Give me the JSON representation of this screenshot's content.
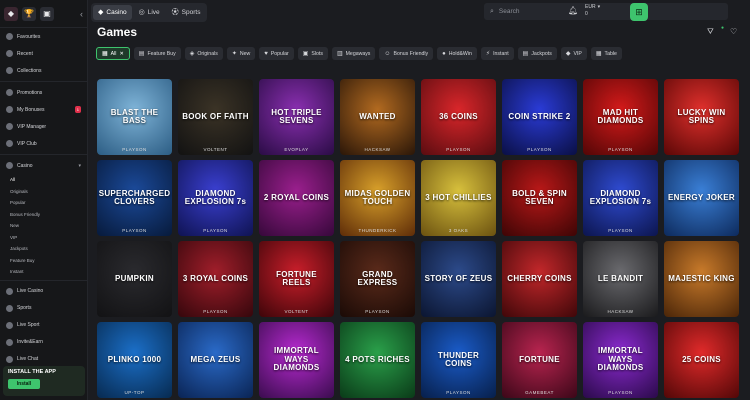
{
  "sidebar": {
    "collapse_icon": "chevron-left-icon",
    "main_items": [
      {
        "label": "Favourites"
      },
      {
        "label": "Recent"
      },
      {
        "label": "Collections"
      }
    ],
    "promo_items": [
      {
        "label": "Promotions"
      },
      {
        "label": "My Bonuses",
        "badge": "1"
      },
      {
        "label": "VIP Manager"
      },
      {
        "label": "VIP Club"
      }
    ],
    "casino": {
      "label": "Casino",
      "sub_items": [
        "All",
        "Originals",
        "Popular",
        "Bonus Friendly",
        "New",
        "VIP",
        "Jackpots",
        "Feature Buy",
        "Instant"
      ]
    },
    "bottom_items": [
      {
        "label": "Live Casino"
      },
      {
        "label": "Sports"
      },
      {
        "label": "Live Sport"
      },
      {
        "label": "Invite&Earn"
      },
      {
        "label": "Live Chat"
      }
    ],
    "install": {
      "title": "INSTALL THE APP",
      "button": "Install"
    }
  },
  "topbar": {
    "tabs": [
      {
        "label": "Casino",
        "icon": "diamond-icon",
        "active": true
      },
      {
        "label": "Live",
        "icon": "live-icon",
        "active": false
      },
      {
        "label": "Sports",
        "icon": "ball-icon",
        "active": false
      }
    ],
    "search_placeholder": "Search",
    "currency": "EUR",
    "balance": "0"
  },
  "main": {
    "title": "Games",
    "filters": [
      {
        "label": "All",
        "active": true
      },
      {
        "label": "Feature Buy"
      },
      {
        "label": "Originals"
      },
      {
        "label": "New"
      },
      {
        "label": "Popular"
      },
      {
        "label": "Slots"
      },
      {
        "label": "Megaways"
      },
      {
        "label": "Bonus Friendly"
      },
      {
        "label": "Hold&Win"
      },
      {
        "label": "Instant"
      },
      {
        "label": "Jackpots"
      },
      {
        "label": "VIP"
      },
      {
        "label": "Table"
      }
    ],
    "games": [
      {
        "name": "BLAST THE BASS",
        "prov": "PLAYSON",
        "c1": "#7fb4d8",
        "c2": "#2c5d84"
      },
      {
        "name": "BOOK OF FAITH",
        "prov": "VOLTENT",
        "c1": "#3b3326",
        "c2": "#121212"
      },
      {
        "name": "HOT TRIPLE SEVENS",
        "prov": "EVOPLAY",
        "c1": "#8a2fb0",
        "c2": "#2a0c45"
      },
      {
        "name": "WANTED",
        "prov": "HACKSAW",
        "c1": "#b26a20",
        "c2": "#2a1608"
      },
      {
        "name": "36 COINS",
        "prov": "PLAYSON",
        "c1": "#d9262a",
        "c2": "#5a0c10"
      },
      {
        "name": "COIN STRIKE 2",
        "prov": "PLAYSON",
        "c1": "#2a3bd6",
        "c2": "#0a0f44"
      },
      {
        "name": "MAD HIT DIAMONDS",
        "prov": "PLAYSON",
        "c1": "#d41a1a",
        "c2": "#520606"
      },
      {
        "name": "LUCKY WIN SPINS",
        "prov": "",
        "c1": "#e0302c",
        "c2": "#5a0706"
      },
      {
        "name": "SUPERCHARGED CLOVERS",
        "prov": "PLAYSON",
        "c1": "#1b4a9a",
        "c2": "#071a3b"
      },
      {
        "name": "DIAMOND EXPLOSION 7s",
        "prov": "PLAYSON",
        "c1": "#3a3fd0",
        "c2": "#0f1352"
      },
      {
        "name": "2 ROYAL COINS",
        "prov": "",
        "c1": "#9a1f8d",
        "c2": "#36083a"
      },
      {
        "name": "MIDAS GOLDEN TOUCH",
        "prov": "THUNDERKICK",
        "c1": "#d8a02a",
        "c2": "#5e2c08"
      },
      {
        "name": "3 HOT CHILLIES",
        "prov": "3 OAKS",
        "c1": "#d7c03c",
        "c2": "#6b5110"
      },
      {
        "name": "BOLD & SPIN SEVEN",
        "prov": "",
        "c1": "#b91818",
        "c2": "#3d0505"
      },
      {
        "name": "DIAMOND EXPLOSION 7s",
        "prov": "PLAYSON",
        "c1": "#2f4bd1",
        "c2": "#0c154e"
      },
      {
        "name": "ENERGY JOKER",
        "prov": "",
        "c1": "#3a7fd6",
        "c2": "#0d2a5c"
      },
      {
        "name": "PUMPKIN",
        "prov": "",
        "c1": "#2a2a2e",
        "c2": "#121214"
      },
      {
        "name": "3 ROYAL COINS",
        "prov": "PLAYSON",
        "c1": "#a01e2a",
        "c2": "#35070c"
      },
      {
        "name": "FORTUNE REELS",
        "prov": "VOLTENT",
        "c1": "#c81e2a",
        "c2": "#3d0509"
      },
      {
        "name": "GRAND EXPRESS",
        "prov": "PLAYSON",
        "c1": "#5a2a1a",
        "c2": "#1a0a06"
      },
      {
        "name": "STORY OF ZEUS",
        "prov": "",
        "c1": "#2c4a8a",
        "c2": "#0b1530"
      },
      {
        "name": "CHERRY COINS",
        "prov": "",
        "c1": "#c2272a",
        "c2": "#3f0709"
      },
      {
        "name": "LE BANDIT",
        "prov": "HACKSAW",
        "c1": "#6a6a6e",
        "c2": "#1a1a1c"
      },
      {
        "name": "MAJESTIC KING",
        "prov": "",
        "c1": "#c87a2a",
        "c2": "#4a2508"
      },
      {
        "name": "PLINKO 1000",
        "prov": "UP-TOP",
        "c1": "#1b6fc8",
        "c2": "#072a50"
      },
      {
        "name": "MEGA ZEUS",
        "prov": "",
        "c1": "#2a6ac8",
        "c2": "#0a2454"
      },
      {
        "name": "IMMORTAL WAYS DIAMONDS",
        "prov": "",
        "c1": "#b72ad0",
        "c2": "#3a0c4e"
      },
      {
        "name": "4 POTS RICHES",
        "prov": "",
        "c1": "#2aa04a",
        "c2": "#0a3a18"
      },
      {
        "name": "THUNDER COINS",
        "prov": "PLAYSON",
        "c1": "#1a5bc8",
        "c2": "#071f4a"
      },
      {
        "name": "FORTUNE",
        "prov": "GAMEBEAT",
        "c1": "#b8244f",
        "c2": "#3b0718"
      },
      {
        "name": "IMMORTAL WAYS DIAMONDS",
        "prov": "PLAYSON",
        "c1": "#8c2ad0",
        "c2": "#2a0a4a"
      },
      {
        "name": "25 COINS",
        "prov": "",
        "c1": "#e02a2a",
        "c2": "#520707"
      }
    ]
  }
}
